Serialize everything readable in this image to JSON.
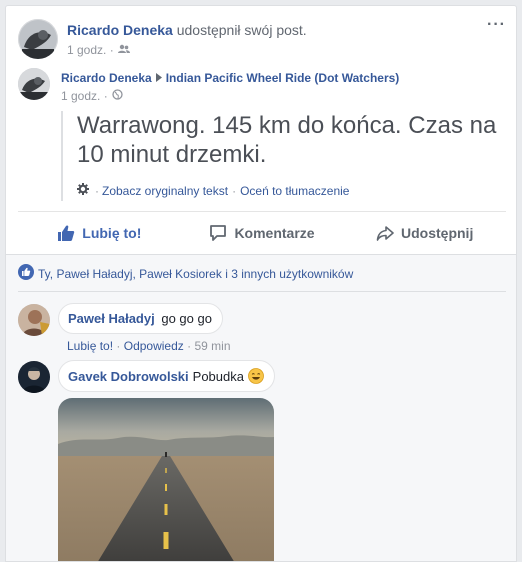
{
  "share": {
    "author": "Ricardo Deneka",
    "action_text": "udostępnił swój post.",
    "time": "1 godz. ·"
  },
  "post": {
    "author": "Ricardo Deneka",
    "group": "Indian Pacific Wheel Ride (Dot Watchers)",
    "time": "1 godz. ·",
    "text_line1": "Warrawong. 145 km do końca. Czas na",
    "text_line2": "10 minut drzemki.",
    "see_original": "Zobacz oryginalny tekst",
    "rate_translation": "Oceń to tłumaczenie",
    "separator": "·"
  },
  "actions": {
    "like": "Lubię to!",
    "comment": "Komentarze",
    "share": "Udostępnij"
  },
  "reactions": {
    "text": "Ty, Paweł Haładyj, Paweł Kosiorek i 3 innych użytkowników"
  },
  "comments": [
    {
      "author": "Paweł Haładyj",
      "text": "go go go",
      "like": "Lubię to!",
      "reply": "Odpowiedz",
      "time": "59 min"
    },
    {
      "author": "Gavek Dobrowolski",
      "text": "Pobudka"
    }
  ],
  "colors": {
    "link": "#365899",
    "like_blue": "#4267b2",
    "muted": "#90949c"
  }
}
